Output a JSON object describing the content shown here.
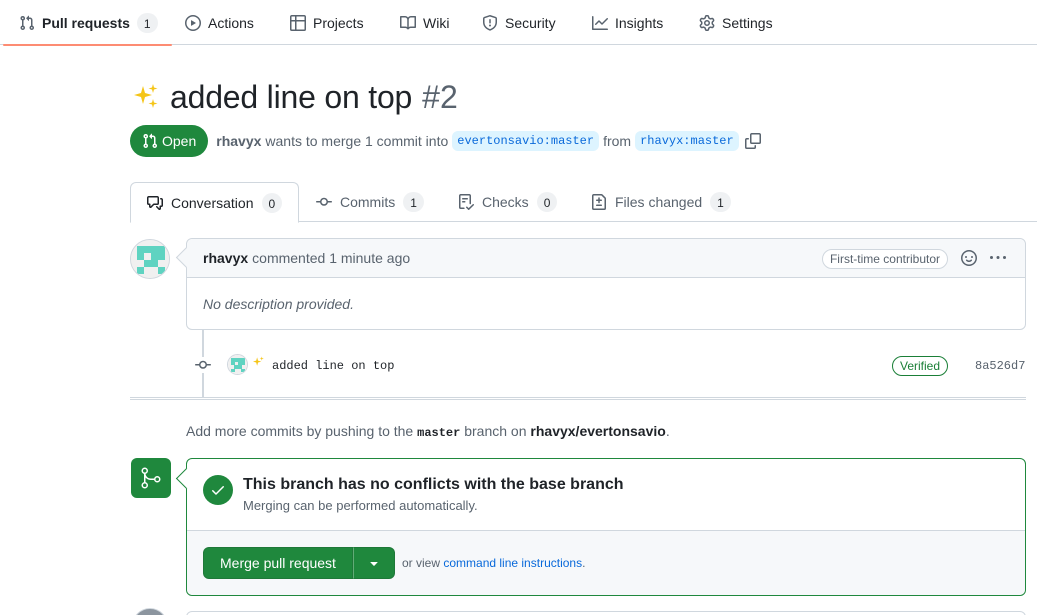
{
  "repo_nav": {
    "items": [
      {
        "label": "Pull requests",
        "icon": "git-pull-request-icon",
        "counter": "1",
        "selected": true
      },
      {
        "label": "Actions",
        "icon": "play-icon"
      },
      {
        "label": "Projects",
        "icon": "table-icon"
      },
      {
        "label": "Wiki",
        "icon": "book-icon"
      },
      {
        "label": "Security",
        "icon": "shield-icon"
      },
      {
        "label": "Insights",
        "icon": "graph-icon"
      },
      {
        "label": "Settings",
        "icon": "gear-icon"
      }
    ]
  },
  "pr": {
    "title_icon": "sparkles-emoji",
    "title": "added line on top",
    "number": "#2",
    "state": "Open",
    "author": "rhavyx",
    "merge_text": "wants to merge 1 commit into",
    "base_ref": "evertonsavio:master",
    "from_text": "from",
    "head_ref": "rhavyx:master"
  },
  "tabs": [
    {
      "label": "Conversation",
      "counter": "0",
      "icon": "comment-discussion-icon",
      "selected": true
    },
    {
      "label": "Commits",
      "counter": "1",
      "icon": "git-commit-icon"
    },
    {
      "label": "Checks",
      "counter": "0",
      "icon": "checklist-icon"
    },
    {
      "label": "Files changed",
      "counter": "1",
      "icon": "file-diff-icon"
    }
  ],
  "comment": {
    "author": "rhavyx",
    "action": "commented 1 minute ago",
    "badge": "First-time contributor",
    "body": "No description provided."
  },
  "commit": {
    "message": "added line on top",
    "verified": "Verified",
    "sha": "8a526d7"
  },
  "push_hint": {
    "prefix": "Add more commits by pushing to the",
    "branch": "master",
    "middle": "branch on",
    "repo": "rhavyx/evertonsavio",
    "suffix": "."
  },
  "merge": {
    "title": "This branch has no conflicts with the base branch",
    "subtitle": "Merging can be performed automatically.",
    "button": "Merge pull request",
    "view_prefix": "or view",
    "view_link": "command line instructions",
    "view_suffix": "."
  },
  "colors": {
    "accent_green": "#1f883d",
    "link_blue": "#0969da",
    "nav_underline": "#fd8c73"
  }
}
